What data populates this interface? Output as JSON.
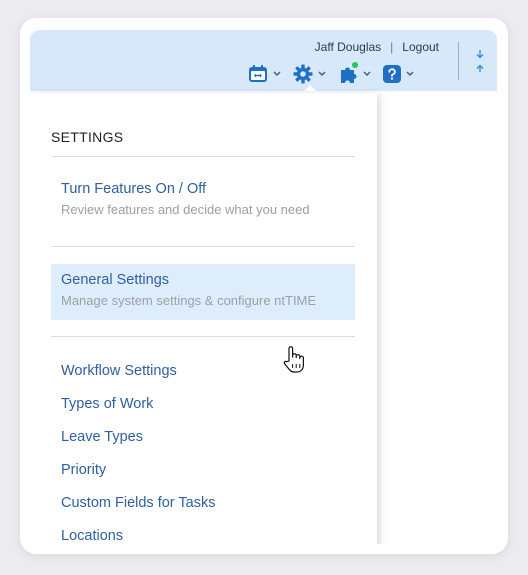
{
  "header": {
    "user_name": "Jaff Douglas",
    "separator": "|",
    "logout_label": "Logout"
  },
  "toolbar_icons": [
    "calendar-icon",
    "gear-icon",
    "puzzle-icon",
    "help-icon",
    "sort-icon"
  ],
  "colors": {
    "topbar_bg": "#d6e8fa",
    "link": "#2f5f9e",
    "highlight_bg": "#deedfb",
    "accent": "#1f6fc5",
    "status_dot": "#22c55e"
  },
  "settings_menu": {
    "heading": "SETTINGS",
    "features": {
      "title": "Turn Features On / Off",
      "description": "Review features and decide what you need"
    },
    "general": {
      "title": "General Settings",
      "description": "Manage system settings & configure ntTIME"
    },
    "links": [
      "Workflow Settings",
      "Types of Work",
      "Leave Types",
      "Priority",
      "Custom Fields for Tasks",
      "Locations"
    ]
  }
}
